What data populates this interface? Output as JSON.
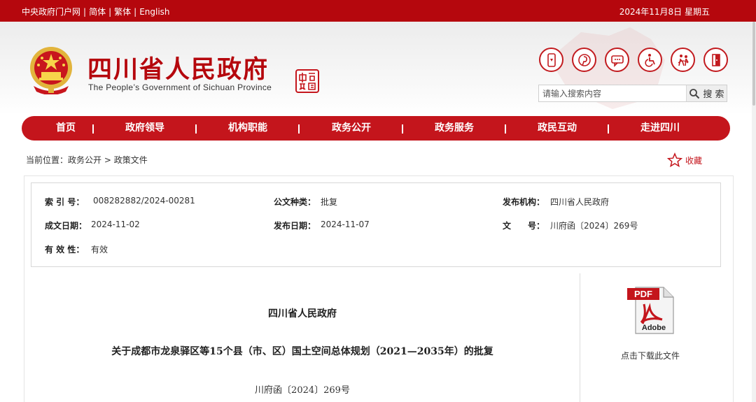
{
  "topbar": {
    "links": [
      "中央政府门户网",
      "简体",
      "繁体",
      "English"
    ],
    "date": "2024年11月8日 星期五"
  },
  "header": {
    "title_cn": "四川省人民政府",
    "title_en": "The People’s Government of Sichuan Province",
    "seal_text": "中国四川"
  },
  "tool_icons": [
    "mobile-icon",
    "pinterest-like-icon",
    "message-icon",
    "accessibility-icon",
    "elder-care-icon",
    "exit-icon"
  ],
  "search": {
    "placeholder": "请输入搜索内容",
    "button_label": "搜 索"
  },
  "nav": {
    "items": [
      "首页",
      "政府领导",
      "机构职能",
      "政务公开",
      "政务服务",
      "政民互动",
      "走进四川"
    ]
  },
  "breadcrumb": {
    "label": "当前位置：",
    "path": [
      "政务公开",
      "政策文件"
    ],
    "separator": ">"
  },
  "favorite": {
    "label": "收藏"
  },
  "meta": {
    "index_no_label": "索 引 号：",
    "index_no": "008282882/2024-00281",
    "doc_type_label": "公文种类：",
    "doc_type": "批复",
    "publisher_label": "发布机构：",
    "publisher": "四川省人民政府",
    "written_date_label": "成文日期：",
    "written_date": "2024-11-02",
    "publish_date_label": "发布日期：",
    "publish_date": "2024-11-07",
    "doc_no_label": "文　　号：",
    "doc_no": "川府函〔2024〕269号",
    "validity_label": "有 效 性：",
    "validity": "有效"
  },
  "document": {
    "org": "四川省人民政府",
    "title": "关于成都市龙泉驿区等15个县（市、区）国土空间总体规划（2021—2035年）的批复",
    "number": "川府函〔2024〕269号"
  },
  "download": {
    "pdf_label": "PDF",
    "brand_label": "Adobe",
    "link_label": "点击下载此文件"
  },
  "colors": {
    "brand_red": "#b5070d",
    "nav_red": "#c4151c"
  }
}
